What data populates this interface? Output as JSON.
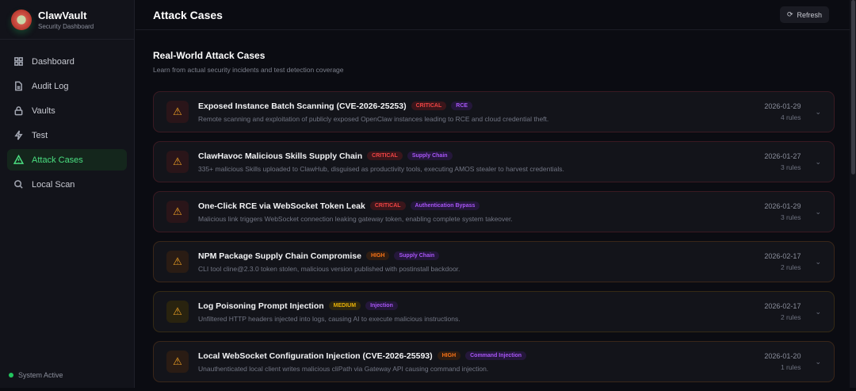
{
  "brand": {
    "title": "ClawVault",
    "subtitle": "Security Dashboard"
  },
  "nav": [
    {
      "label": "Dashboard",
      "icon": "grid-icon"
    },
    {
      "label": "Audit Log",
      "icon": "file-icon"
    },
    {
      "label": "Vaults",
      "icon": "lock-icon"
    },
    {
      "label": "Test",
      "icon": "zap-icon"
    },
    {
      "label": "Attack Cases",
      "icon": "alert-triangle-icon",
      "active": true
    },
    {
      "label": "Local Scan",
      "icon": "search-icon"
    }
  ],
  "status": "System Active",
  "header": {
    "title": "Attack Cases",
    "refresh": "Refresh"
  },
  "section": {
    "title": "Real-World Attack Cases",
    "subtitle": "Learn from actual security incidents and test detection coverage"
  },
  "cases": [
    {
      "title": "Exposed Instance Batch Scanning (CVE-2026-25253)",
      "severity": "CRITICAL",
      "category": "RCE",
      "description": "Remote scanning and exploitation of publicly exposed OpenClaw instances leading to RCE and cloud credential theft.",
      "date": "2026-01-29",
      "rules": "4 rules"
    },
    {
      "title": "ClawHavoc Malicious Skills Supply Chain",
      "severity": "CRITICAL",
      "category": "Supply Chain",
      "description": "335+ malicious Skills uploaded to ClawHub, disguised as productivity tools, executing AMOS stealer to harvest credentials.",
      "date": "2026-01-27",
      "rules": "3 rules"
    },
    {
      "title": "One-Click RCE via WebSocket Token Leak",
      "severity": "CRITICAL",
      "category": "Authentication Bypass",
      "description": "Malicious link triggers WebSocket connection leaking gateway token, enabling complete system takeover.",
      "date": "2026-01-29",
      "rules": "3 rules"
    },
    {
      "title": "NPM Package Supply Chain Compromise",
      "severity": "HIGH",
      "category": "Supply Chain",
      "description": "CLI tool cline@2.3.0 token stolen, malicious version published with postinstall backdoor.",
      "date": "2026-02-17",
      "rules": "2 rules"
    },
    {
      "title": "Log Poisoning Prompt Injection",
      "severity": "MEDIUM",
      "category": "Injection",
      "description": "Unfiltered HTTP headers injected into logs, causing AI to execute malicious instructions.",
      "date": "2026-02-17",
      "rules": "2 rules"
    },
    {
      "title": "Local WebSocket Configuration Injection (CVE-2026-25593)",
      "severity": "HIGH",
      "category": "Command Injection",
      "description": "Unauthenticated local client writes malicious cliPath via Gateway API causing command injection.",
      "date": "2026-01-20",
      "rules": "1 rules"
    }
  ]
}
